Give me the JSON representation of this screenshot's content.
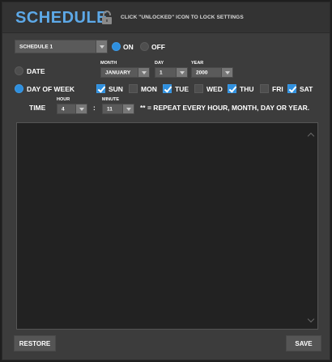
{
  "header": {
    "title": "SCHEDULE",
    "lock_icon": "padlock-icon",
    "hint": "CLICK \"UNLOCKED\" ICON TO LOCK SETTINGS"
  },
  "schedule_select": {
    "value": "SCHEDULE 1"
  },
  "state": {
    "on_label": "ON",
    "off_label": "OFF",
    "selected": "ON"
  },
  "date": {
    "label": "DATE",
    "month": {
      "label": "MONTH",
      "value": "JANUARY"
    },
    "day": {
      "label": "DAY",
      "value": "1"
    },
    "year": {
      "label": "YEAR",
      "value": "2000"
    }
  },
  "day_of_week": {
    "label": "DAY OF WEEK",
    "selected": true,
    "days": [
      {
        "label": "SUN",
        "checked": true
      },
      {
        "label": "MON",
        "checked": false
      },
      {
        "label": "TUE",
        "checked": true
      },
      {
        "label": "WED",
        "checked": false
      },
      {
        "label": "THU",
        "checked": true
      },
      {
        "label": "FRI",
        "checked": false
      },
      {
        "label": "SAT",
        "checked": true
      }
    ]
  },
  "time": {
    "label": "TIME",
    "hour": {
      "label": "HOUR",
      "value": "4"
    },
    "separator": ":",
    "minute": {
      "label": "MINUTE",
      "value": "11"
    },
    "note": "** = REPEAT EVERY HOUR, MONTH, DAY OR YEAR."
  },
  "footer": {
    "restore_label": "RESTORE",
    "save_label": "SAVE"
  },
  "colors": {
    "accent": "#2e8fde",
    "title": "#5da9e8",
    "panel": "#3c3c3c"
  }
}
